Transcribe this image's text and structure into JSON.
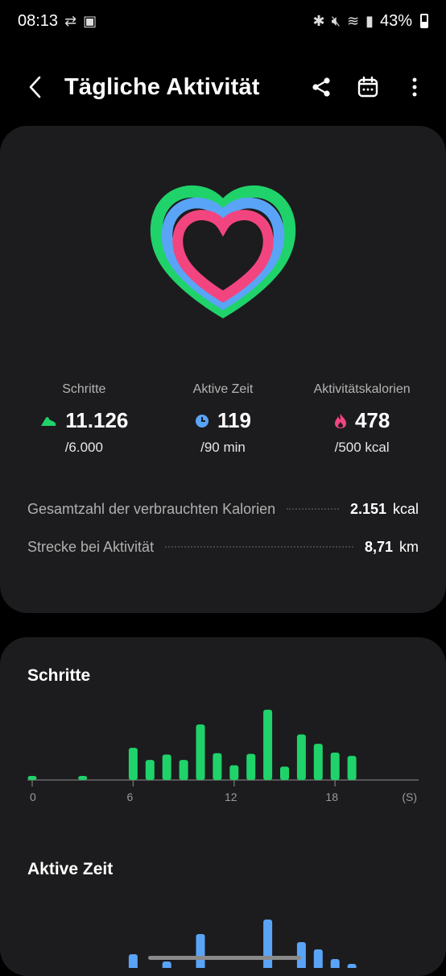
{
  "status": {
    "time": "08:13",
    "battery": "43%"
  },
  "header": {
    "title": "Tägliche Aktivität",
    "back_icon": "back-arrow-icon",
    "share_icon": "share-icon",
    "calendar_icon": "calendar-icon",
    "more_icon": "more-vertical-icon"
  },
  "summary": {
    "rings": {
      "steps_progress": 1.0,
      "active_time_progress": 1.0,
      "calories_progress": 0.956,
      "colors": {
        "steps": "#1fd36a",
        "active": "#5aa4f7",
        "calories": "#f2457f"
      }
    },
    "stats": [
      {
        "label": "Schritte",
        "value": "11.126",
        "goal": "/6.000",
        "icon": "shoe-icon",
        "color": "#1fd36a"
      },
      {
        "label": "Aktive Zeit",
        "value": "119",
        "goal": "/90 min",
        "icon": "clock-icon",
        "color": "#5aa4f7"
      },
      {
        "label": "Aktivitätskalorien",
        "value": "478",
        "goal": "/500 kcal",
        "icon": "flame-icon",
        "color": "#f2457f"
      }
    ],
    "total_calories": {
      "label": "Gesamtzahl der verbrauchten Kalorien",
      "value": "2.151",
      "unit": "kcal"
    },
    "distance": {
      "label": "Strecke bei Aktivität",
      "value": "8,71",
      "unit": "km"
    }
  },
  "steps_section": {
    "title": "Schritte"
  },
  "active_section": {
    "title": "Aktive Zeit"
  },
  "chart_data": [
    {
      "type": "bar",
      "title": "Schritte",
      "x_ticks": [
        "0",
        "6",
        "12",
        "18"
      ],
      "x_unit": "(S)",
      "x": [
        0,
        3,
        6,
        7,
        8,
        9,
        10,
        11,
        12,
        13,
        14,
        15,
        16,
        17,
        18,
        19
      ],
      "values": [
        6,
        6,
        48,
        30,
        38,
        30,
        83,
        40,
        22,
        39,
        105,
        20,
        68,
        54,
        41,
        36
      ],
      "color": "#1fd36a"
    },
    {
      "type": "bar",
      "title": "Aktive Zeit",
      "x": [
        6,
        8,
        10,
        14,
        16,
        17,
        18,
        19
      ],
      "values": [
        17,
        8,
        42,
        60,
        32,
        23,
        11,
        5
      ],
      "color": "#5aa4f7"
    }
  ]
}
